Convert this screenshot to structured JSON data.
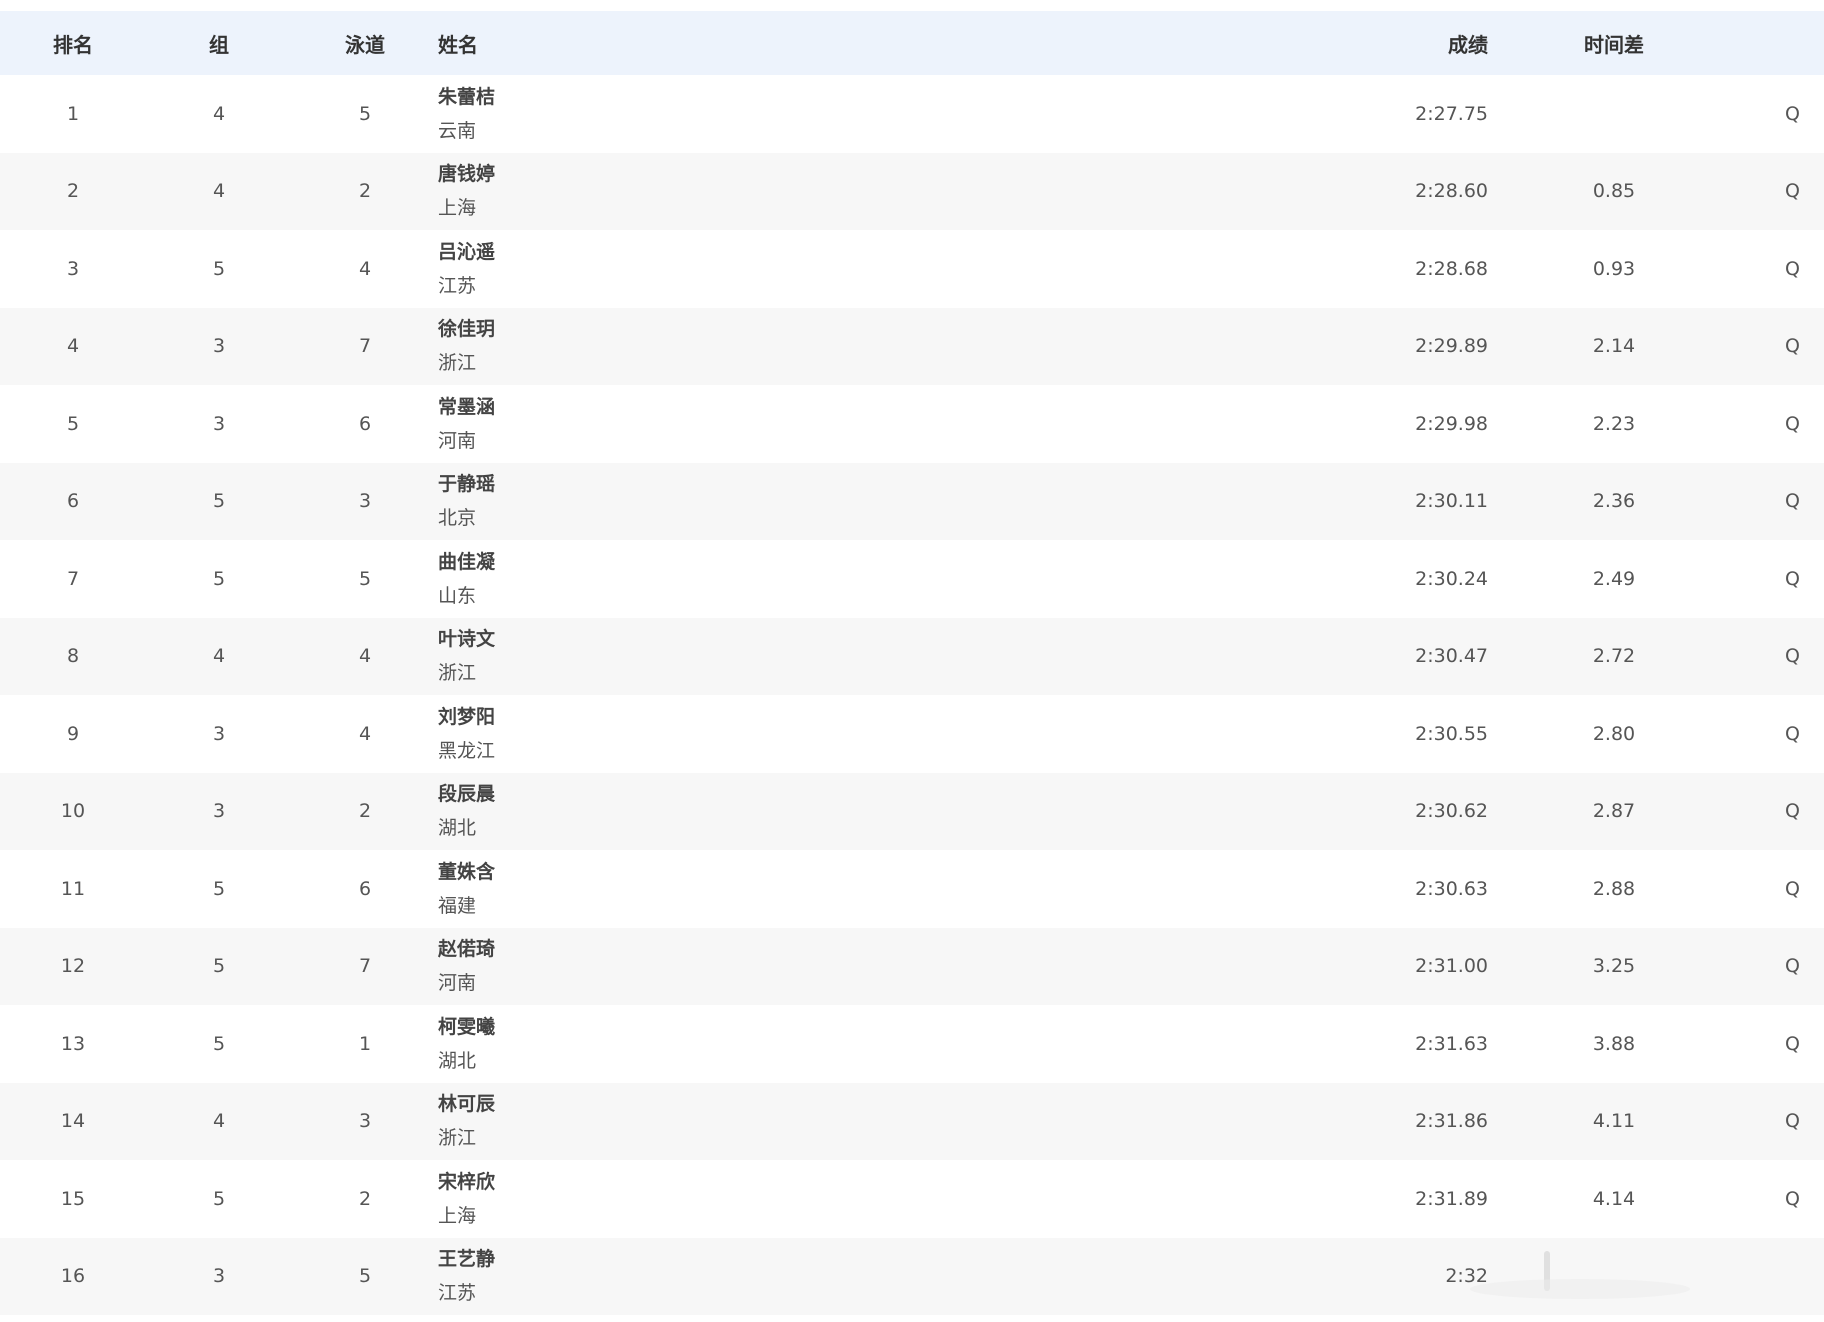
{
  "table": {
    "headers": {
      "rank": "排名",
      "group": "组",
      "lane": "泳道",
      "name": "姓名",
      "result": "成绩",
      "time_diff": "时间差"
    },
    "rows": [
      {
        "rank": "1",
        "group": "4",
        "lane": "5",
        "name": "朱蕾桔",
        "team": "云南",
        "result": "2:27.75",
        "diff": "",
        "qualifier": "Q"
      },
      {
        "rank": "2",
        "group": "4",
        "lane": "2",
        "name": "唐钱婷",
        "team": "上海",
        "result": "2:28.60",
        "diff": "0.85",
        "qualifier": "Q"
      },
      {
        "rank": "3",
        "group": "5",
        "lane": "4",
        "name": "吕沁遥",
        "team": "江苏",
        "result": "2:28.68",
        "diff": "0.93",
        "qualifier": "Q"
      },
      {
        "rank": "4",
        "group": "3",
        "lane": "7",
        "name": "徐佳玥",
        "team": "浙江",
        "result": "2:29.89",
        "diff": "2.14",
        "qualifier": "Q"
      },
      {
        "rank": "5",
        "group": "3",
        "lane": "6",
        "name": "常墨涵",
        "team": "河南",
        "result": "2:29.98",
        "diff": "2.23",
        "qualifier": "Q"
      },
      {
        "rank": "6",
        "group": "5",
        "lane": "3",
        "name": "于静瑶",
        "team": "北京",
        "result": "2:30.11",
        "diff": "2.36",
        "qualifier": "Q"
      },
      {
        "rank": "7",
        "group": "5",
        "lane": "5",
        "name": "曲佳凝",
        "team": "山东",
        "result": "2:30.24",
        "diff": "2.49",
        "qualifier": "Q"
      },
      {
        "rank": "8",
        "group": "4",
        "lane": "4",
        "name": "叶诗文",
        "team": "浙江",
        "result": "2:30.47",
        "diff": "2.72",
        "qualifier": "Q"
      },
      {
        "rank": "9",
        "group": "3",
        "lane": "4",
        "name": "刘梦阳",
        "team": "黑龙江",
        "result": "2:30.55",
        "diff": "2.80",
        "qualifier": "Q"
      },
      {
        "rank": "10",
        "group": "3",
        "lane": "2",
        "name": "段辰晨",
        "team": "湖北",
        "result": "2:30.62",
        "diff": "2.87",
        "qualifier": "Q"
      },
      {
        "rank": "11",
        "group": "5",
        "lane": "6",
        "name": "董姝含",
        "team": "福建",
        "result": "2:30.63",
        "diff": "2.88",
        "qualifier": "Q"
      },
      {
        "rank": "12",
        "group": "5",
        "lane": "7",
        "name": "赵偌琦",
        "team": "河南",
        "result": "2:31.00",
        "diff": "3.25",
        "qualifier": "Q"
      },
      {
        "rank": "13",
        "group": "5",
        "lane": "1",
        "name": "柯雯曦",
        "team": "湖北",
        "result": "2:31.63",
        "diff": "3.88",
        "qualifier": "Q"
      },
      {
        "rank": "14",
        "group": "4",
        "lane": "3",
        "name": "林可辰",
        "team": "浙江",
        "result": "2:31.86",
        "diff": "4.11",
        "qualifier": "Q"
      },
      {
        "rank": "15",
        "group": "5",
        "lane": "2",
        "name": "宋梓欣",
        "team": "上海",
        "result": "2:31.89",
        "diff": "4.14",
        "qualifier": "Q"
      },
      {
        "rank": "16",
        "group": "3",
        "lane": "5",
        "name": "王艺静",
        "team": "江苏",
        "result": "2:32",
        "diff": "",
        "qualifier": ""
      }
    ]
  },
  "colors": {
    "header_bg": "#edf3fc",
    "row_alt_bg": "#f7f7f7",
    "text": "#555555",
    "header_text": "#333333"
  }
}
